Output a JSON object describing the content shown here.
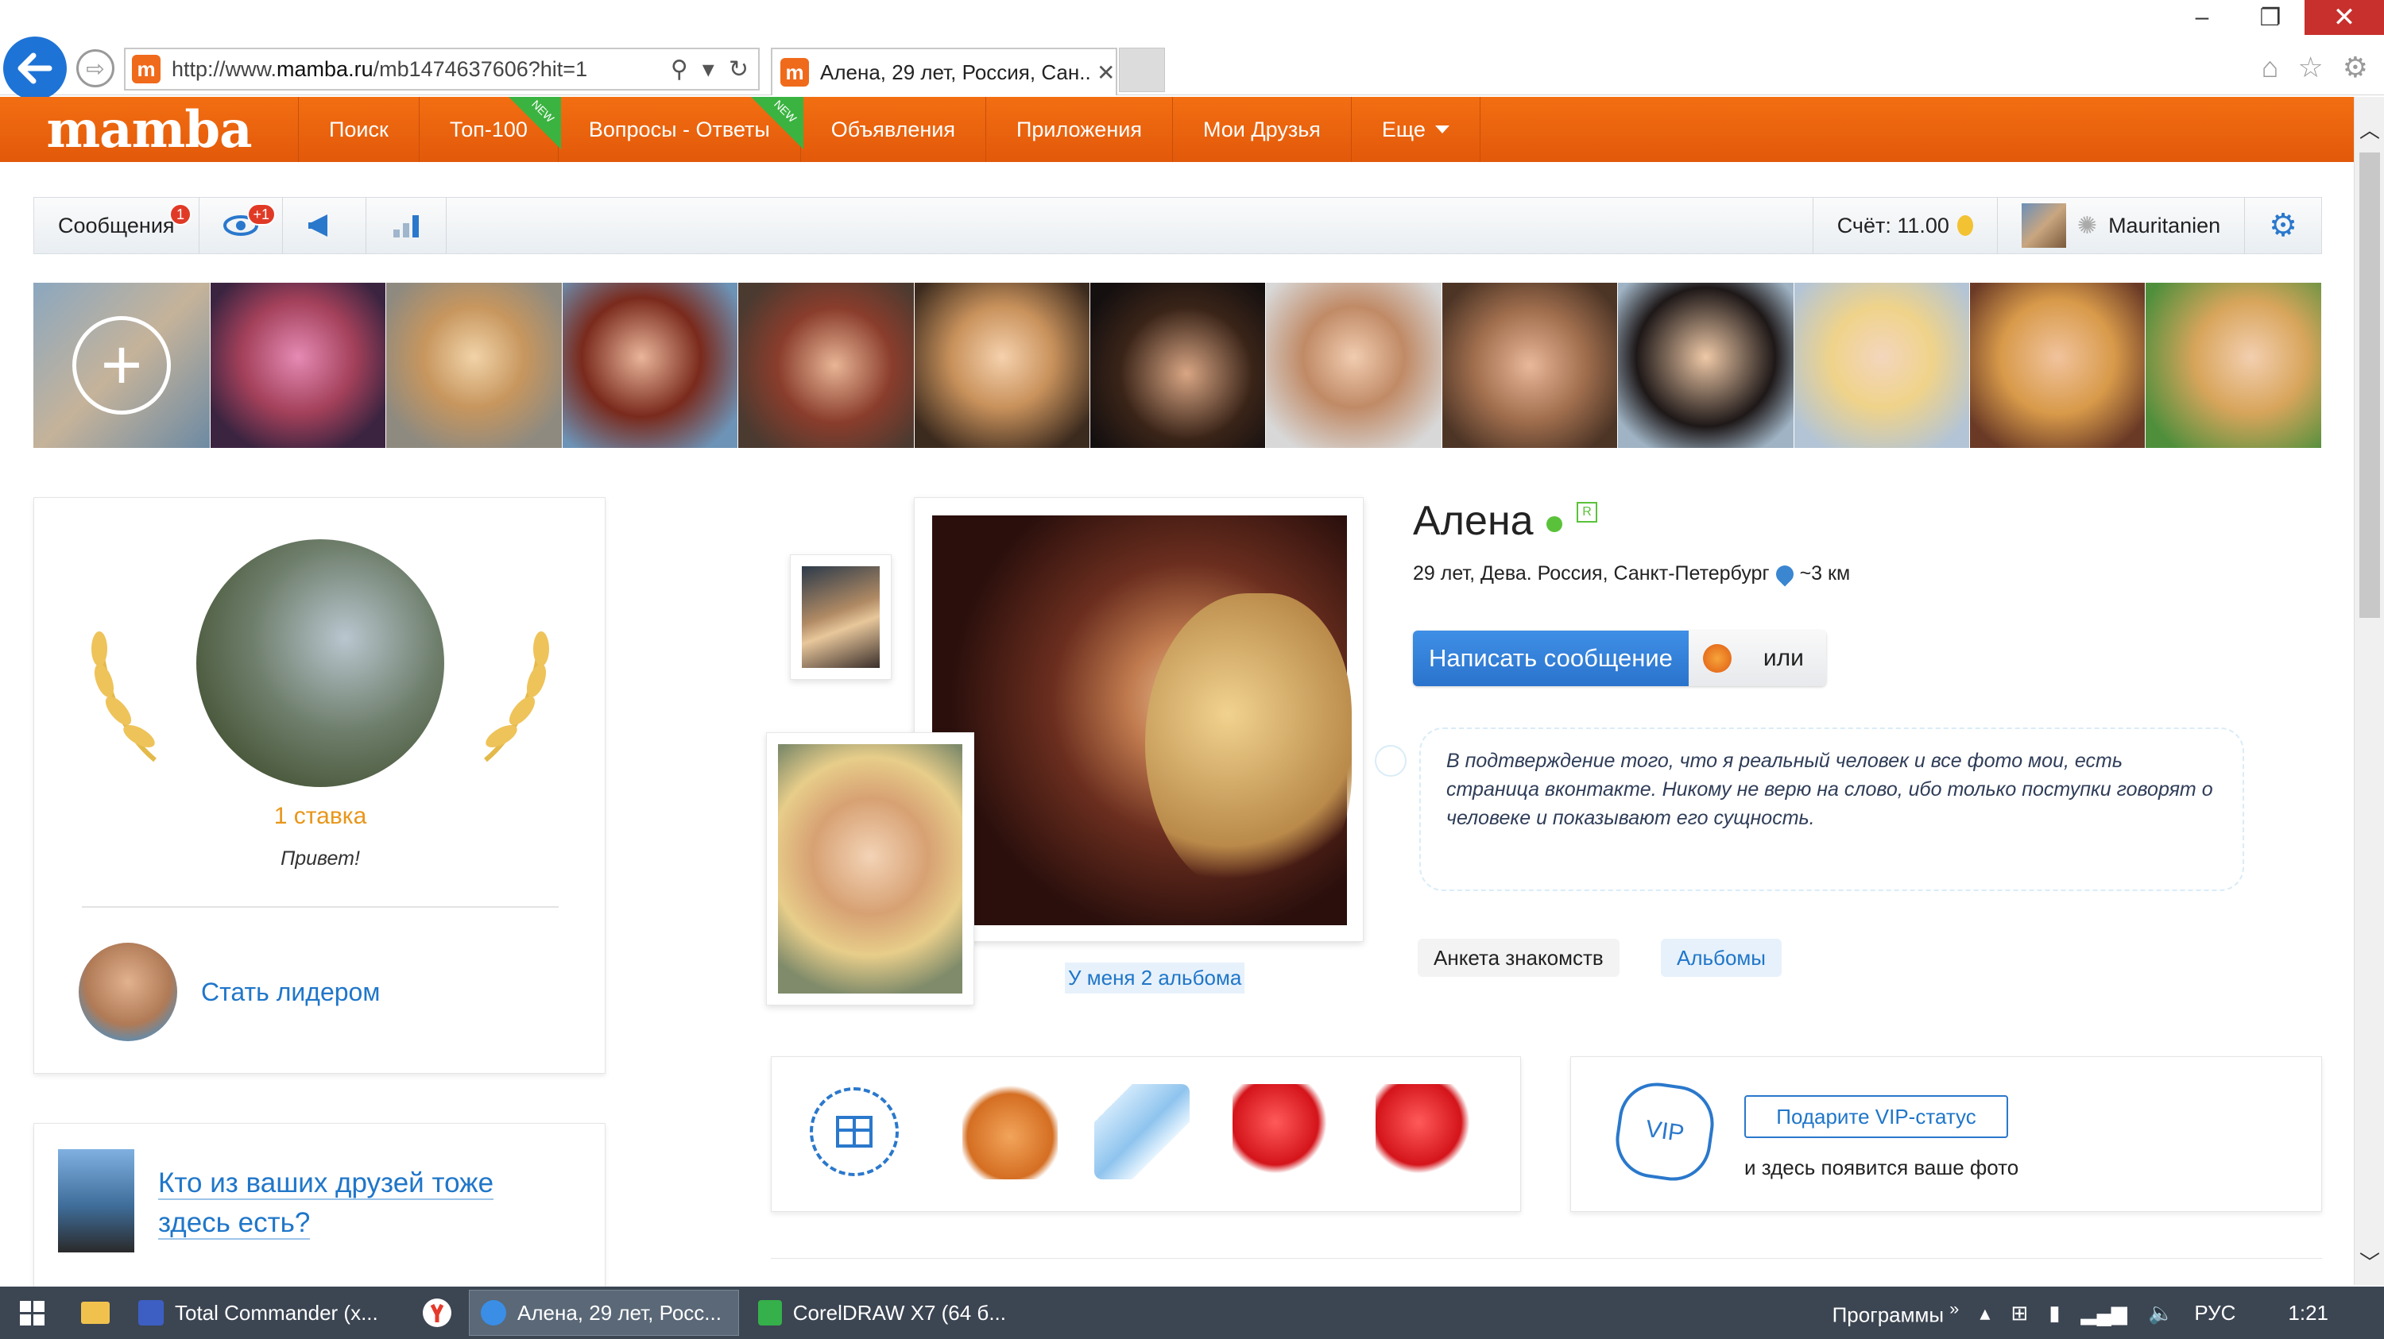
{
  "browser": {
    "url_prefix": "http://www.",
    "url_domain": "mamba.ru",
    "url_path": "/mb1474637606?hit=1",
    "tab_title": "Алена, 29 лет, Россия, Сан...",
    "favicon_letter": "m"
  },
  "site_nav": {
    "logo": "mamba",
    "items": [
      {
        "label": "Поиск",
        "new": ""
      },
      {
        "label": "Топ-100",
        "new": "NEW"
      },
      {
        "label": "Вопросы - Ответы",
        "new": "NEW"
      },
      {
        "label": "Объявления",
        "new": ""
      },
      {
        "label": "Приложения",
        "new": ""
      },
      {
        "label": "Мои Друзья",
        "new": ""
      },
      {
        "label": "Еще",
        "new": ""
      }
    ]
  },
  "toolbar": {
    "messages_label": "Сообщения",
    "messages_badge": "1",
    "views_badge": "+1",
    "balance": "Счёт: 11.00",
    "username": "Mauritanien"
  },
  "leader": {
    "bets": "1 ставка",
    "greeting": "Привет!",
    "become_leader": "Стать лидером"
  },
  "friends": {
    "link_line1": "Кто из ваших друзей тоже",
    "link_line2": "здесь есть?"
  },
  "gallery": {
    "albums_link": "У меня 2 альбома"
  },
  "profile": {
    "name": "Алена",
    "real_badge": "R",
    "details": "29 лет, Дева. Россия, Санкт-Петербург",
    "distance": "~3 км",
    "write_button": "Написать сообщение",
    "or_label": "или",
    "status": "В подтверждение того, что я реальный человек и все фото мои, есть страница вконтакте. Никому не верю на слово, ибо только поступки говорят о человеке и показывают его сущность.",
    "tabs": [
      "Анкета знакомств",
      "Альбомы"
    ]
  },
  "vip": {
    "badge": "VIP",
    "button": "Подарите VIP-статус",
    "note": "и здесь появится ваше фото"
  },
  "taskbar": {
    "apps": [
      "Total Commander (x...",
      "Алена, 29 лет, Росс...",
      "CorelDRAW X7 (64 б..."
    ],
    "programs": "Программы",
    "chevron": "»",
    "lang": "РУС",
    "time": "1:21"
  },
  "colors": {
    "brand_orange": "#f06a1b",
    "link_blue": "#1f76c9",
    "online_green": "#5ac23a",
    "bet_orange": "#e8961a"
  }
}
